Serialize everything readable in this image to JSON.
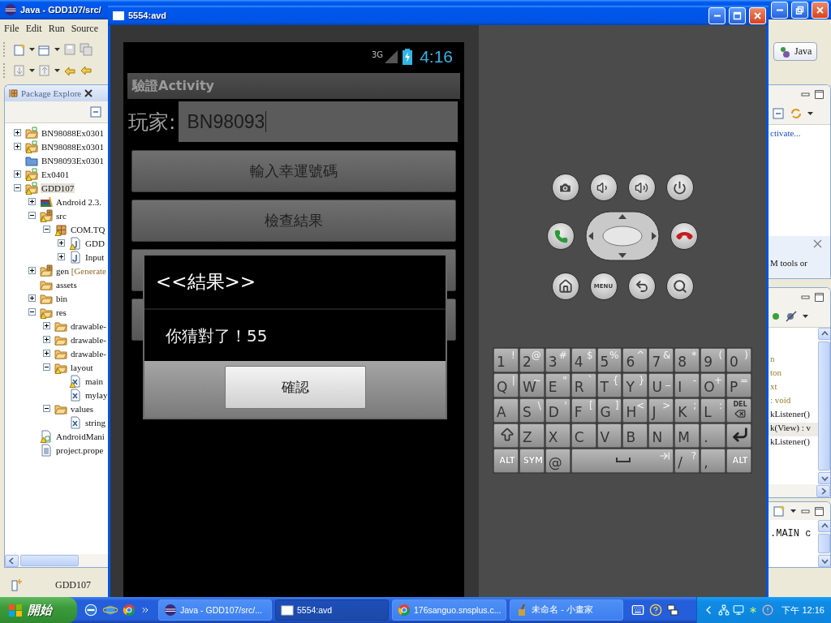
{
  "eclipse": {
    "title": "Java - GDD107/src/",
    "menu": [
      "File",
      "Edit",
      "Run",
      "Source"
    ],
    "perspective": "Java",
    "package_explorer": {
      "title": "Package Explore",
      "tree": [
        {
          "label": "BN98088Ex0301",
          "kind": "project",
          "warning": false,
          "expanded": false,
          "selected": false
        },
        {
          "label": "BN98088Ex0301",
          "kind": "project",
          "warning": true,
          "expanded": false,
          "selected": false
        },
        {
          "label": "BN98093Ex0301",
          "kind": "closed-project",
          "warning": false,
          "selected": false
        },
        {
          "label": "Ex0401",
          "kind": "project",
          "warning": true,
          "expanded": false,
          "selected": false
        },
        {
          "label": "GDD107",
          "kind": "project",
          "warning": true,
          "expanded": true,
          "selected": true,
          "children": [
            {
              "label": "Android 2.3.",
              "kind": "library",
              "warning": false,
              "expanded": false,
              "selected": false
            },
            {
              "label": "src",
              "kind": "source-folder",
              "warning": true,
              "expanded": true,
              "selected": false,
              "children": [
                {
                  "label": "COM.TQ",
                  "kind": "package",
                  "warning": true,
                  "expanded": true,
                  "selected": false,
                  "children": [
                    {
                      "label": "GDD",
                      "kind": "java",
                      "warning": true,
                      "expanded": false,
                      "selected": false
                    },
                    {
                      "label": "Input",
                      "kind": "java",
                      "warning": false,
                      "expanded": false,
                      "selected": false
                    }
                  ]
                }
              ]
            },
            {
              "label": "gen",
              "note": "[Generate",
              "kind": "source-folder",
              "warning": false,
              "expanded": false,
              "selected": false
            },
            {
              "label": "assets",
              "kind": "folder",
              "warning": false,
              "selected": false
            },
            {
              "label": "bin",
              "kind": "folder",
              "warning": false,
              "expanded": false,
              "selected": false
            },
            {
              "label": "res",
              "kind": "folder",
              "warning": true,
              "expanded": true,
              "selected": false,
              "children": [
                {
                  "label": "drawable-",
                  "kind": "folder",
                  "warning": false,
                  "expanded": false,
                  "selected": false
                },
                {
                  "label": "drawable-",
                  "kind": "folder",
                  "warning": false,
                  "expanded": false,
                  "selected": false
                },
                {
                  "label": "drawable-",
                  "kind": "folder",
                  "warning": false,
                  "expanded": false,
                  "selected": false
                },
                {
                  "label": "layout",
                  "kind": "folder",
                  "warning": true,
                  "expanded": true,
                  "selected": false,
                  "children": [
                    {
                      "label": "main",
                      "kind": "xml",
                      "warning": true,
                      "selected": false
                    },
                    {
                      "label": "mylay",
                      "kind": "xml",
                      "warning": false,
                      "selected": false
                    }
                  ]
                },
                {
                  "label": "values",
                  "kind": "folder",
                  "warning": false,
                  "expanded": true,
                  "selected": false,
                  "children": [
                    {
                      "label": "string",
                      "kind": "xml",
                      "warning": false,
                      "selected": false
                    }
                  ]
                }
              ]
            },
            {
              "label": "AndroidMani",
              "kind": "manifest",
              "warning": true,
              "selected": false
            },
            {
              "label": "project.prope",
              "kind": "text",
              "warning": false,
              "selected": false
            }
          ]
        }
      ]
    },
    "right_panel": {
      "link": "ctivate...",
      "message": "M tools or"
    },
    "outline": [
      {
        "text": "n",
        "kind": "type",
        "selected": false
      },
      {
        "text": "ton",
        "kind": "type",
        "selected": false
      },
      {
        "text": "xt",
        "kind": "type",
        "selected": false
      },
      {
        "text": ": void",
        "kind": "type",
        "selected": false
      },
      {
        "text": "kListener()",
        "kind": "member",
        "selected": false
      },
      {
        "text": "k(View) : v",
        "kind": "member",
        "selected": true
      },
      {
        "text": "kListener()",
        "kind": "member",
        "selected": false
      }
    ],
    "console": ".MAIN c",
    "status": "GDD107"
  },
  "emulator": {
    "title": "5554:avd",
    "phone": {
      "network": "3G",
      "clock": "4:16",
      "app_title": "驗證Activity",
      "player_label": "玩家:",
      "player_value": "BN98093",
      "buttons": [
        {
          "kind": "labeled",
          "label": "輸入幸運號碼"
        },
        {
          "kind": "labeled",
          "label": "檢查結果"
        },
        {
          "kind": "covered"
        },
        {
          "kind": "covered"
        }
      ],
      "dialog": {
        "title": "<<結果>>",
        "message": "你猜對了！55",
        "button": "確認"
      }
    },
    "menu_key": "MENU",
    "keyboard": [
      [
        {
          "kind": "char",
          "main": "1",
          "alt": "!"
        },
        {
          "kind": "char",
          "main": "2",
          "alt": "@"
        },
        {
          "kind": "char",
          "main": "3",
          "alt": "#"
        },
        {
          "kind": "char",
          "main": "4",
          "alt": "$"
        },
        {
          "kind": "char",
          "main": "5",
          "alt": "%"
        },
        {
          "kind": "char",
          "main": "6",
          "alt": "^"
        },
        {
          "kind": "char",
          "main": "7",
          "alt": "&"
        },
        {
          "kind": "char",
          "main": "8",
          "alt": "*"
        },
        {
          "kind": "char",
          "main": "9",
          "alt": "("
        },
        {
          "kind": "char",
          "main": "0",
          "alt": ")"
        }
      ],
      [
        {
          "kind": "char",
          "main": "Q",
          "alt": "|"
        },
        {
          "kind": "char",
          "main": "W",
          "alt": "~"
        },
        {
          "kind": "char",
          "main": "E",
          "alt": "\""
        },
        {
          "kind": "char",
          "main": "R",
          "alt": "`"
        },
        {
          "kind": "char",
          "main": "T",
          "alt": "{"
        },
        {
          "kind": "char",
          "main": "Y",
          "alt": "}"
        },
        {
          "kind": "char",
          "main": "U",
          "alt": "_"
        },
        {
          "kind": "char",
          "main": "I",
          "alt": "-"
        },
        {
          "kind": "char",
          "main": "O",
          "alt": "+"
        },
        {
          "kind": "char",
          "main": "P",
          "alt": "="
        }
      ],
      [
        {
          "kind": "char",
          "main": "A"
        },
        {
          "kind": "char",
          "main": "S",
          "alt": "\\"
        },
        {
          "kind": "char",
          "main": "D",
          "alt": "'"
        },
        {
          "kind": "char",
          "main": "F",
          "alt": "["
        },
        {
          "kind": "char",
          "main": "G",
          "alt": "]"
        },
        {
          "kind": "char",
          "main": "H",
          "alt": "<"
        },
        {
          "kind": "char",
          "main": "J",
          "alt": ">"
        },
        {
          "kind": "char",
          "main": "K",
          "alt": ";"
        },
        {
          "kind": "char",
          "main": "L",
          "alt": ":"
        },
        {
          "kind": "del",
          "main": "DEL"
        }
      ],
      [
        {
          "kind": "shift"
        },
        {
          "kind": "char",
          "main": "Z"
        },
        {
          "kind": "char",
          "main": "X"
        },
        {
          "kind": "char",
          "main": "C"
        },
        {
          "kind": "char",
          "main": "V"
        },
        {
          "kind": "char",
          "main": "B"
        },
        {
          "kind": "char",
          "main": "N"
        },
        {
          "kind": "char",
          "main": "M"
        },
        {
          "kind": "char",
          "main": "."
        },
        {
          "kind": "enter"
        }
      ],
      [
        {
          "kind": "label",
          "main": "ALT"
        },
        {
          "kind": "label",
          "main": "SYM"
        },
        {
          "kind": "char",
          "main": "@"
        },
        {
          "kind": "space"
        },
        {
          "kind": "char",
          "main": "/",
          "alt": "?"
        },
        {
          "kind": "char",
          "main": ","
        },
        {
          "kind": "label",
          "main": "ALT"
        }
      ]
    ]
  },
  "taskbar": {
    "start": "開始",
    "tasks": [
      {
        "label": "Java - GDD107/src/...",
        "kind": "eclipse",
        "selected": false
      },
      {
        "label": "5554:avd",
        "kind": "window",
        "selected": true
      },
      {
        "label": "176sanguo.snsplus.c...",
        "kind": "browser",
        "selected": false
      },
      {
        "label": "未命名 - 小畫家",
        "kind": "paint",
        "selected": false
      }
    ],
    "clock": "下午 12:16"
  }
}
